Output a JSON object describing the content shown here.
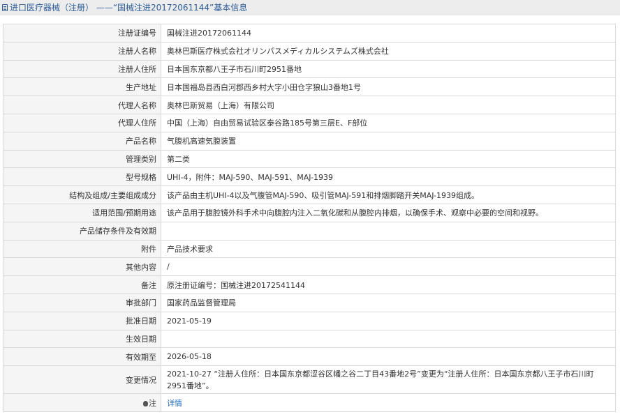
{
  "header": {
    "title": "进口医疗器械（注册） ——“国械注进20172061144”基本信息"
  },
  "rows": [
    {
      "label": "注册证编号",
      "value": "国械注进20172061144"
    },
    {
      "label": "注册人名称",
      "value": "奥林巴斯医疗株式会社オリンパスメディカルシステムズ株式会社"
    },
    {
      "label": "注册人住所",
      "value": "日本国东京都八王子市石川町2951番地"
    },
    {
      "label": "生产地址",
      "value": "日本国福岛县西白河郡西乡村大字小田仓字狼山3番地1号"
    },
    {
      "label": "代理人名称",
      "value": "奥林巴斯贸易（上海）有限公司"
    },
    {
      "label": "代理人住所",
      "value": "中国（上海）自由贸易试验区泰谷路185号第三层E、F部位"
    },
    {
      "label": "产品名称",
      "value": "气腹机高速気腹装置"
    },
    {
      "label": "管理类别",
      "value": "第二类"
    },
    {
      "label": "型号规格",
      "value": "UHI-4，附件：MAJ-590、MAJ-591、MAJ-1939"
    },
    {
      "label": "结构及组成/主要组成成分",
      "value": "该产品由主机UHI-4以及气腹管MAJ-590、吸引管MAJ-591和排烟脚踏开关MAJ-1939组成。"
    },
    {
      "label": "适用范围/预期用途",
      "value": "该产品用于腹腔镜外科手术中向腹腔内注入二氧化碳和从腹腔内排烟，以确保手术、观察中必要的空间和视野。"
    },
    {
      "label": "产品储存条件及有效期",
      "value": ""
    },
    {
      "label": "附件",
      "value": "产品技术要求"
    },
    {
      "label": "其他内容",
      "value": "/"
    },
    {
      "label": "备注",
      "value": "原注册证编号：国械注进20172541144"
    },
    {
      "label": "审批部门",
      "value": "国家药品监督管理局"
    },
    {
      "label": "批准日期",
      "value": "2021-05-19"
    },
    {
      "label": "生效日期",
      "value": ""
    },
    {
      "label": "有效期至",
      "value": "2026-05-18"
    },
    {
      "label": "变更情况",
      "value": "2021-10-27 “注册人住所：日本国东京都涩谷区幡之谷二丁目43番地2号”变更为“注册人住所：日本国东京都八王子市石川町2951番地”。"
    }
  ],
  "note": {
    "label": "注",
    "link_text": "详情",
    "icon": "lightbulb-icon"
  },
  "colors": {
    "title_bar_bg": "#ededed",
    "title_text": "#2a5d9b",
    "label_bg": "#f5f5f5",
    "border": "#d9d9d9",
    "link": "#1f6fc5"
  }
}
